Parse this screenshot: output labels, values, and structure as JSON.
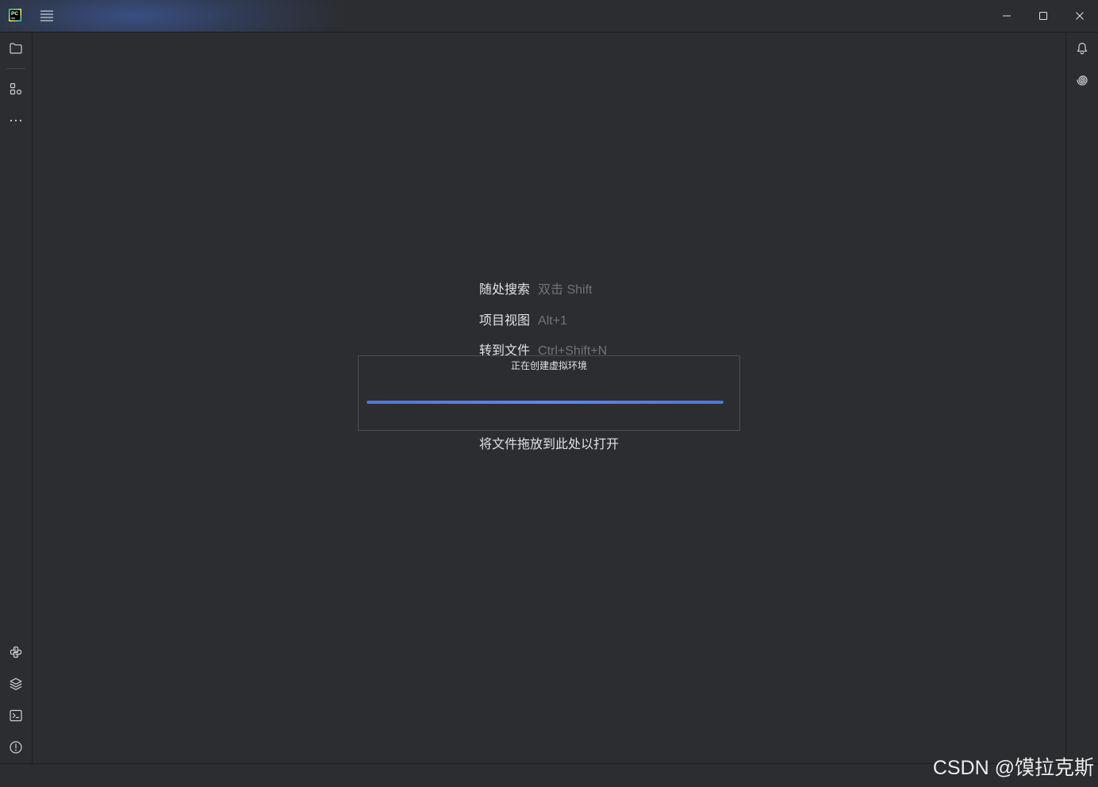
{
  "title_bar": {
    "logo": {
      "icon": "pycharm-logo-icon",
      "text": "PC"
    },
    "main_menu": {
      "icon": "hamburger-menu-icon"
    },
    "window_controls": [
      {
        "icon": "minimize-icon"
      },
      {
        "icon": "maximize-icon"
      },
      {
        "icon": "close-icon"
      }
    ]
  },
  "left_stripe": {
    "top": [
      {
        "icon": "folder-icon"
      },
      {
        "icon": "structure-icon"
      },
      {
        "icon": "more-dots-icon"
      }
    ],
    "bottom": [
      {
        "icon": "python-icon"
      },
      {
        "icon": "layers-icon"
      },
      {
        "icon": "terminal-icon"
      },
      {
        "icon": "exclamation-circle-icon"
      }
    ]
  },
  "right_stripe": [
    {
      "icon": "bell-icon"
    },
    {
      "icon": "spiral-icon"
    }
  ],
  "empty_editor": {
    "hints": [
      {
        "label": "随处搜索",
        "shortcut": "双击 Shift"
      },
      {
        "label": "项目视图",
        "shortcut": "Alt+1"
      },
      {
        "label": "转到文件",
        "shortcut": "Ctrl+Shift+N"
      }
    ],
    "drop_hint": "将文件拖放到此处以打开"
  },
  "progress_dialog": {
    "title": "正在创建虚拟环境",
    "progress": 1
  },
  "watermark": "CSDN @馍拉克斯",
  "colors": {
    "background": "#2b2d30",
    "separator": "#1e1f22",
    "text": "#dfe1e5",
    "hint_text": "#6f737a",
    "icon": "#ced0d6",
    "accent": "#548af7",
    "dialog_border": "#4b4e54",
    "stripe_divider": "#43454a"
  }
}
